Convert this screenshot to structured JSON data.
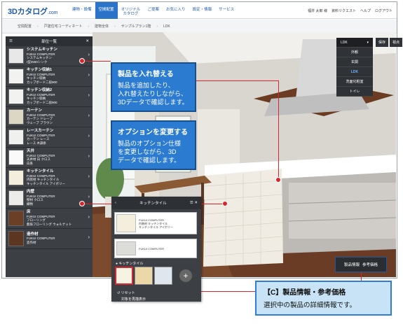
{
  "header": {
    "logo": "3Dカタログ",
    "logo_suffix": ".com",
    "nav": [
      "建物・設備",
      "空間配置",
      "オリジナルカタログ",
      "ご提案",
      "お気に入り",
      "設定・情報",
      "サービス"
    ],
    "right": [
      "福井 太郎 様",
      "資料リクエスト",
      "ヘルプ",
      "ログアウト"
    ]
  },
  "breadcrumb": [
    "空間配置",
    "戸建住宅コーディネート",
    "建物全体",
    "サンプルプラン1階",
    "LDK"
  ],
  "sidebar": {
    "title": "部位一覧",
    "items": [
      {
        "name": "システムキッチン",
        "l1": "FUKUI COMPUTER",
        "l2": "システムキッチン",
        "l3": "I型2550シンク"
      },
      {
        "name": "キッチン収納1",
        "l1": "FUKUI COMPUTER",
        "l2": "キッチン収納",
        "l3": "カップボード二段900"
      },
      {
        "name": "キッチン収納2",
        "l1": "FUKUI COMPUTER",
        "l2": "キッチン収納",
        "l3": "カップボード二段900"
      },
      {
        "name": "カーテン",
        "l1": "FUKUI COMPUTER",
        "l2": "カーテン ドレープ",
        "l3": "ウェーブ ブラウン"
      },
      {
        "name": "レースカーテン",
        "l1": "FUKUI COMPUTER",
        "l2": "カーテン レース",
        "l3": "レース 木調条"
      },
      {
        "name": "天井",
        "l1": "FUKUI COMPUTER",
        "l2": "天井材 白 クロス",
        "l3": "白系"
      },
      {
        "name": "キッチンタイル",
        "l1": "FUKUI COMPUTER",
        "l2": "内装材 キッチンタイル",
        "l3": "キッチンタイル アイボリー"
      },
      {
        "name": "内壁",
        "l1": "FUKUI COMPUTER",
        "l2": "壁材 クロス",
        "l3": "織物"
      },
      {
        "name": "床",
        "l1": "FUKUI COMPUTER",
        "l2": "フローリング",
        "l3": "無垢フローリング ウォルナット"
      },
      {
        "name": "造作材",
        "l1": "FUKUI COMPUTER",
        "l2": "造作材",
        "l3": ""
      }
    ]
  },
  "view_menu": {
    "title": "LDK",
    "items": [
      "外観",
      "玄関",
      "LDK",
      "洗面化粧室",
      "トイレ"
    ],
    "selected": "LDK",
    "buttons": [
      "保存",
      "視点"
    ]
  },
  "callouts": {
    "replace_title": "製品を入れ替える",
    "replace_body": [
      "製品を追加したり、",
      "入れ替えたりしながら、",
      "3Dデータで確認します。"
    ],
    "option_title": "オプションを変更する",
    "option_body": [
      "製品のオプション仕様",
      "を変更しながら、3D",
      "データで確認します。"
    ]
  },
  "option_panel": {
    "title": "キッチンタイル",
    "card1": {
      "l1": "FUKUI COMPUTER",
      "l2": "内装材 キッチンタイル",
      "l3": "キッチンタイル アイボリー"
    },
    "card2": {
      "l1": "FUKUI COMPUTER"
    },
    "section_label": "● キッチンタイル",
    "plus_label": "追加",
    "reset_label": "リセット",
    "apply_label": "対象を再描表示"
  },
  "price_button": {
    "label1": "製品情報",
    "label2": "参考価格"
  },
  "info_box": {
    "title": "【C】製品情報・参考価格",
    "body": "選択中の製品の詳細情報です。"
  },
  "colors": {
    "accent": "#2b7bd1",
    "marker": "#d8262d",
    "panel": "#3c3f44"
  }
}
